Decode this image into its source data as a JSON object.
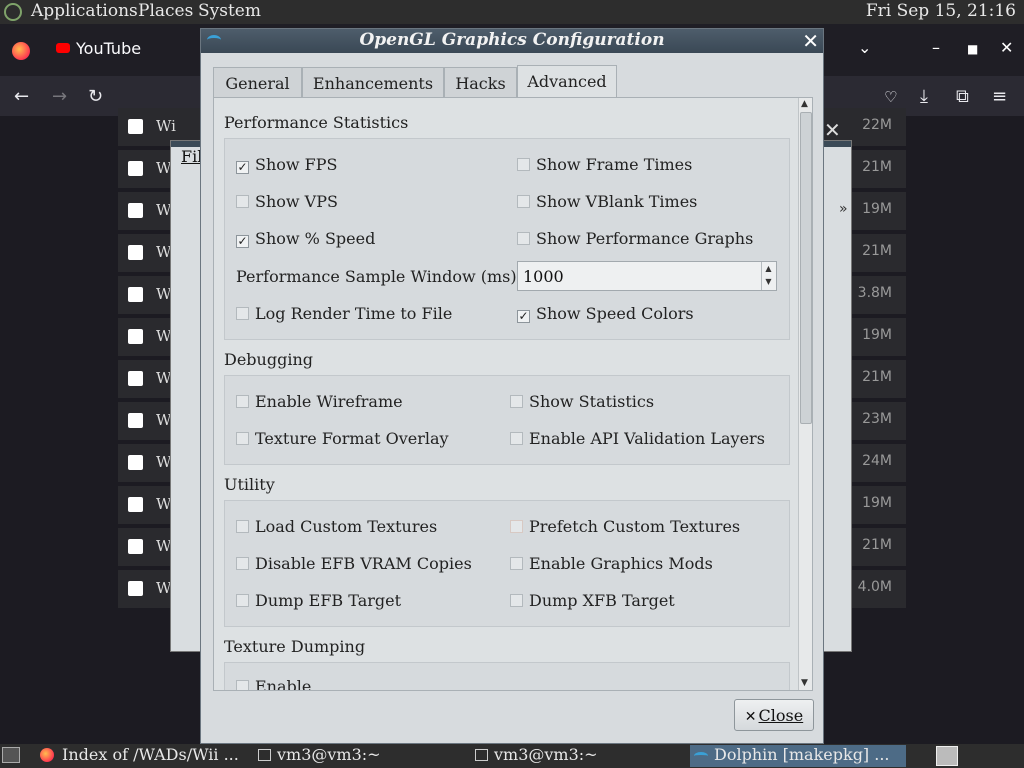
{
  "top_panel": {
    "menus": [
      "Applications",
      "Places",
      "System"
    ],
    "clock": "Fri Sep 15, 21:16"
  },
  "firefox": {
    "tab_title": "YouTube",
    "rows": [
      {
        "name": "Wi",
        "size": "22M"
      },
      {
        "name": "Wi",
        "size": "21M"
      },
      {
        "name": "Wi",
        "size": "19M"
      },
      {
        "name": "Wi",
        "size": "21M"
      },
      {
        "name": "Wi",
        "size": "3.8M"
      },
      {
        "name": "Wi",
        "size": "19M"
      },
      {
        "name": "Wi",
        "size": "21M"
      },
      {
        "name": "Wi",
        "size": "23M"
      },
      {
        "name": "Wi",
        "size": "24M"
      },
      {
        "name": "Wi",
        "size": "19M"
      },
      {
        "name": "Wi",
        "size": "21M"
      },
      {
        "name": "Wi",
        "size": "4.0M"
      }
    ]
  },
  "dolphin_main": {
    "menu_file": "Fil",
    "overflow": "»"
  },
  "dialog": {
    "title": "OpenGL Graphics Configuration",
    "tabs": [
      "General",
      "Enhancements",
      "Hacks",
      "Advanced"
    ],
    "active_tab": "Advanced",
    "performance": {
      "title": "Performance Statistics",
      "show_fps": "Show FPS",
      "show_frame_times": "Show Frame Times",
      "show_vps": "Show VPS",
      "show_vblank_times": "Show VBlank Times",
      "show_speed": "Show % Speed",
      "show_perf_graphs": "Show Performance Graphs",
      "sample_window_label": "Performance Sample Window (ms):",
      "sample_window_value": "1000",
      "log_render_time": "Log Render Time to File",
      "show_speed_colors": "Show Speed Colors"
    },
    "debugging": {
      "title": "Debugging",
      "wireframe": "Enable Wireframe",
      "statistics": "Show Statistics",
      "texture_overlay": "Texture Format Overlay",
      "api_validation": "Enable API Validation Layers"
    },
    "utility": {
      "title": "Utility",
      "load_custom_textures": "Load Custom Textures",
      "prefetch_custom_textures": "Prefetch Custom Textures",
      "disable_efb_vram": "Disable EFB VRAM Copies",
      "graphics_mods": "Enable Graphics Mods",
      "dump_efb": "Dump EFB Target",
      "dump_xfb": "Dump XFB Target"
    },
    "texture_dumping": {
      "title": "Texture Dumping",
      "enable": "Enable"
    },
    "checked_mark": "✓",
    "close_label": "Close",
    "close_x": "✕"
  },
  "taskbar": {
    "tasks": [
      {
        "label": "Index of /WADs/Wii ..."
      },
      {
        "label": "vm3@vm3:~"
      },
      {
        "label": "vm3@vm3:~"
      },
      {
        "label": "Dolphin [makepkg] ..."
      }
    ]
  }
}
